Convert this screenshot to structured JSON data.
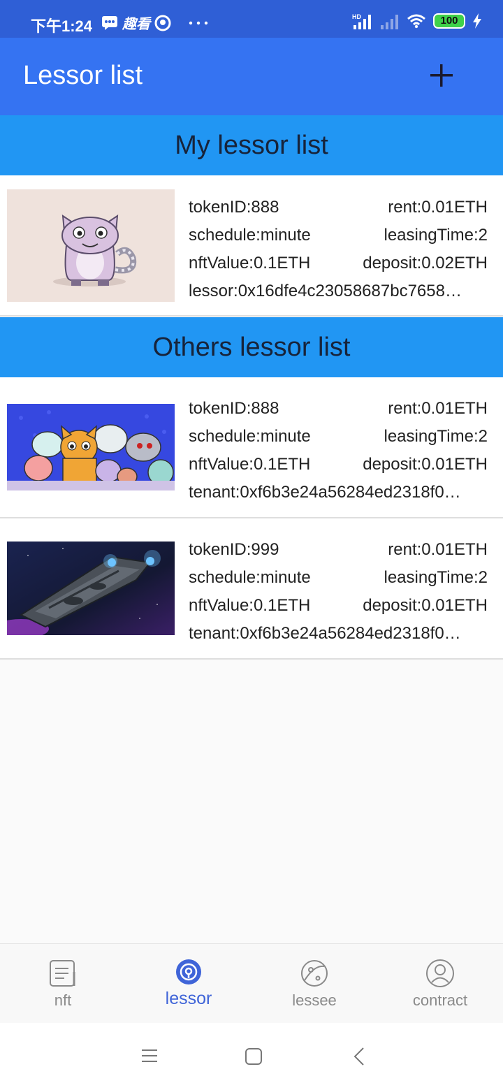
{
  "status": {
    "time": "下午1:24",
    "battery": "100",
    "apps": [
      "chat-icon",
      "app-text-icon",
      "app-circle-icon",
      "more-dots-icon"
    ],
    "app_text": "趣看"
  },
  "header": {
    "title": "Lessor list"
  },
  "my_section": {
    "title": "My lessor list",
    "items": [
      {
        "image": "cryptokitty-lavender-cat",
        "token": "tokenID:888",
        "rent": "rent:0.01ETH",
        "schedule": "schedule:minute",
        "leasing": "leasingTime:2",
        "nft_value": "nftValue:0.1ETH",
        "deposit": "deposit:0.02ETH",
        "addr": "lessor:0x16dfe4c23058687bc7658…"
      }
    ]
  },
  "others_section": {
    "title": "Others lessor list",
    "items": [
      {
        "image": "cryptokitties-group",
        "token": "tokenID:888",
        "rent": "rent:0.01ETH",
        "schedule": "schedule:minute",
        "leasing": "leasingTime:2",
        "nft_value": "nftValue:0.1ETH",
        "deposit": "deposit:0.01ETH",
        "addr": "tenant:0xf6b3e24a56284ed2318f0…"
      },
      {
        "image": "spaceship",
        "token": "tokenID:999",
        "rent": "rent:0.01ETH",
        "schedule": "schedule:minute",
        "leasing": "leasingTime:2",
        "nft_value": "nftValue:0.1ETH",
        "deposit": "deposit:0.01ETH",
        "addr": "tenant:0xf6b3e24a56284ed2318f0…"
      }
    ]
  },
  "bottom_nav": {
    "items": [
      {
        "label": "nft",
        "icon": "document-icon",
        "active": false
      },
      {
        "label": "lessor",
        "icon": "target-icon",
        "active": true
      },
      {
        "label": "lessee",
        "icon": "planet-icon",
        "active": false
      },
      {
        "label": "contract",
        "icon": "user-circle-icon",
        "active": false
      }
    ]
  },
  "colors": {
    "status_bar": "#2f5fd6",
    "app_bar": "#3573f2",
    "section_header": "#2196f3",
    "active_nav": "#3f64d8"
  }
}
